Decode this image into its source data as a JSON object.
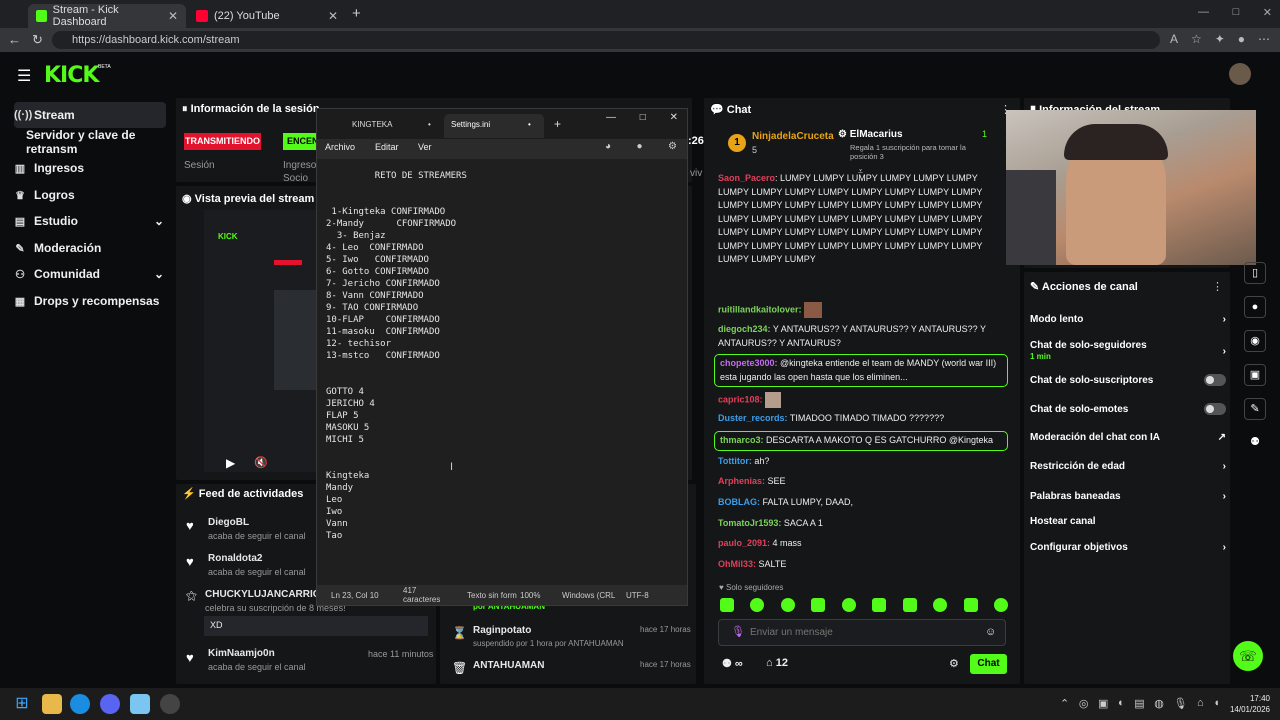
{
  "browser": {
    "tabs": [
      {
        "label": "Stream - Kick Dashboard"
      },
      {
        "label": "(22) YouTube"
      }
    ],
    "url": "https://dashboard.kick.com/stream"
  },
  "header": {
    "logo": "KICK",
    "beta": "BETA"
  },
  "sidebar": {
    "items": [
      {
        "label": "Stream"
      },
      {
        "label": "Servidor y clave de retransm"
      },
      {
        "label": "Ingresos"
      },
      {
        "label": "Logros"
      },
      {
        "label": "Estudio"
      },
      {
        "label": "Moderación"
      },
      {
        "label": "Comunidad"
      },
      {
        "label": "Drops y recompensas"
      }
    ]
  },
  "session_panel": {
    "title": "Información de la sesión",
    "live_badge": "TRANSMITIENDO",
    "on_badge": "ENCEN",
    "session_label": "Sesión",
    "ingresos_label": "Ingreso",
    "socio_label": "Socio",
    "clock_partial": ":26",
    "viv": "viv"
  },
  "preview": {
    "title": "Vista previa del stream"
  },
  "activity": {
    "title": "Feed de actividades",
    "items": [
      {
        "name": "DiegoBL",
        "action": "acaba de seguir el canal",
        "time": ""
      },
      {
        "name": "Ronaldota2",
        "action": "acaba de seguir el canal",
        "time": ""
      },
      {
        "name": "CHUCKYLUJANCARRION",
        "action": "celebra su suscripción de 8 meses!",
        "time": "",
        "message": "XD"
      },
      {
        "name": "KimNaamjo0n",
        "action": "acaba de seguir el canal",
        "time": "hace 11 minutos"
      }
    ]
  },
  "mod_log": {
    "partial_user": "por ANTAHUAMAN",
    "items": [
      {
        "name": "Raginpotato",
        "action": "suspendido por 1 hora por ANTAHUAMAN",
        "time": "hace 17 horas"
      },
      {
        "name": "ANTAHUAMAN",
        "action": "",
        "time": "hace 17 horas"
      }
    ]
  },
  "notepad": {
    "tabs": [
      {
        "label": "KINGTEKA"
      },
      {
        "label": "Settings.ini"
      }
    ],
    "menu": [
      "Archivo",
      "Editar",
      "Ver"
    ],
    "content": "         RETO DE STREAMERS\n\n\n 1-Kingteka CONFIRMADO\n2-Mandy      CFONFIRMADO\n  3- Benjaz\n4- Leo  CONFIRMADO\n5- Iwo   CONFIRMADO\n6- Gotto CONFIRMADO\n7- Jericho CONFIRMADO\n8- Vann CONFIRMADO\n9- TAO CONFIRMADO\n10-FLAP    CONFIRMADO\n11-masoku  CONFIRMADO\n12- techisor\n13-mstco   CONFIRMADO\n\n\nGOTTO 4\nJERICHO 4\nFLAP 5\nMASOKU 5\nMICHI 5\n\n\nKingteka\nMandy\nLeo\nIwo\nVann\nTao",
    "status": {
      "position": "Ln 23, Col 10",
      "chars": "417 caracteres",
      "format": "Texto sin form",
      "zoom": "100%",
      "eol": "Windows (CRL",
      "encoding": "UTF-8"
    }
  },
  "chat": {
    "title": "Chat",
    "pinned": [
      {
        "name": "NinjadelaCruceta",
        "count": "5"
      },
      {
        "name": "ElMacarius",
        "sub": "Regala 1 suscripción para tomar la posición 3",
        "count": "1"
      }
    ],
    "spam_user": "Saon_Pacero",
    "spam_text": "LUMPY LUMPY LUMPY LUMPY LUMPY LUMPY LUMPY LUMPY LUMPY LUMPY LUMPY LUMPY LUMPY LUMPY LUMPY LUMPY LUMPY LUMPY LUMPY LUMPY LUMPY LUMPY LUMPY LUMPY LUMPY LUMPY LUMPY LUMPY LUMPY LUMPY LUMPY LUMPY LUMPY LUMPY LUMPY LUMPY LUMPY LUMPY LUMPY LUMPY LUMPY LUMPY LUMPY LUMPY LUMPY LUMPY LUMPY LUMPY LUMPY",
    "messages": [
      {
        "user": "ruitillandkaitolover:",
        "text": "",
        "color": "#7dd35a"
      },
      {
        "user": "diegoch234:",
        "text": "Y ANTAURUS?? Y ANTAURUS?? Y ANTAURUS?? Y ANTAURUS?? Y ANTAURUS?",
        "color": "#7dd35a"
      },
      {
        "user": "chopete3000:",
        "text": "@kingteka entiende el team de MANDY (world war III) esta jugando las open hasta que los eliminen...",
        "color": "#c56cf0"
      },
      {
        "user": "capric108:",
        "text": "",
        "color": "#e0405a"
      },
      {
        "user": "Duster_records:",
        "text": "TIMADOO TIMADO TIMADO ???????",
        "color": "#3c9ee8"
      },
      {
        "user": "thmarco3:",
        "text": "DESCARTA A MAKOTO Q ES GATCHURRO @Kingteka",
        "color": "#7dd35a"
      },
      {
        "user": "Tottitor:",
        "text": "ah?",
        "color": "#3c9ee8"
      },
      {
        "user": "Arphenias:",
        "text": "SEE",
        "color": "#e0405a"
      },
      {
        "user": "BOBLAG:",
        "text": "FALTA LUMPY, DAAD,",
        "color": "#3c9ee8"
      },
      {
        "user": "TomatoJr1593:",
        "text": "SACA A 1",
        "color": "#7dd35a"
      },
      {
        "user": "paulo_2091:",
        "text": "4 mass",
        "color": "#e0405a"
      },
      {
        "user": "OhMil33:",
        "text": "SALTE",
        "color": "#e0405a"
      }
    ],
    "followers_only": "Solo seguidores",
    "input_placeholder": "Enviar un mensaje",
    "infinity": "∞",
    "count": "12",
    "send": "Chat"
  },
  "stream_info": {
    "title": "Información del stream"
  },
  "actions": {
    "title": "Acciones de canal",
    "items": [
      {
        "label": "Modo lento",
        "sub": ""
      },
      {
        "label": "Chat de solo-seguidores",
        "sub": "1 min"
      },
      {
        "label": "Chat de solo-suscriptores",
        "sub": ""
      },
      {
        "label": "Chat de solo-emotes",
        "sub": ""
      },
      {
        "label": "Moderación del chat con IA",
        "sub": ""
      },
      {
        "label": "Restricción de edad",
        "sub": ""
      },
      {
        "label": "Palabras baneadas",
        "sub": ""
      },
      {
        "label": "Hostear canal",
        "sub": ""
      },
      {
        "label": "Configurar objetivos",
        "sub": ""
      }
    ]
  },
  "taskbar": {
    "time": "17:40",
    "date": "14/01/2026"
  },
  "colors": {
    "brand": "#53fc18",
    "live": "#e3132d"
  }
}
